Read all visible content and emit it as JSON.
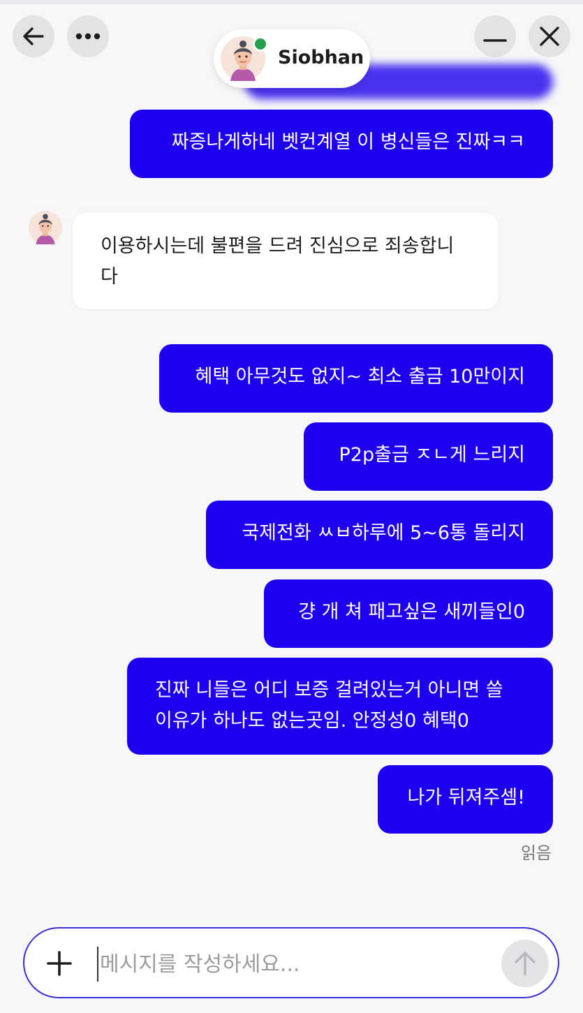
{
  "header": {
    "agent_name": "Siobhan",
    "agent_status": "online",
    "icons": [
      "back-arrow-icon",
      "more-icon",
      "minimize-icon",
      "close-icon"
    ]
  },
  "colors": {
    "outgoing_bubble": "#1e00ef",
    "incoming_bubble": "#ffffff",
    "online_dot": "#22a04b",
    "composer_border": "#3b2fd6"
  },
  "messages": [
    {
      "from": "user",
      "text": "짜증나게하네 벳컨계열 이 병신들은 진짜ㅋㅋ"
    },
    {
      "from": "agent",
      "text": "이용하시는데 불편을 드려 진심으로 죄송합니다"
    },
    {
      "from": "user",
      "text": "혜택 아무것도 없지~ 최소 출금 10만이지"
    },
    {
      "from": "user",
      "text": "P2p출금 ㅈㄴ게 느리지"
    },
    {
      "from": "user",
      "text": "국제전화 ㅆㅂ하루에 5~6통 돌리지"
    },
    {
      "from": "user",
      "text": "걍 개 쳐 패고싶은 새끼들인0"
    },
    {
      "from": "user",
      "text": "진짜 니들은 어디 보증 걸려있는거 아니면 쓸 이유가 하나도 없는곳임. 안정성0 혜택0"
    },
    {
      "from": "user",
      "text": "나가 뒤져주셈!"
    }
  ],
  "read_status": "읽음",
  "composer": {
    "placeholder": "메시지를 작성하세요...",
    "value": ""
  }
}
